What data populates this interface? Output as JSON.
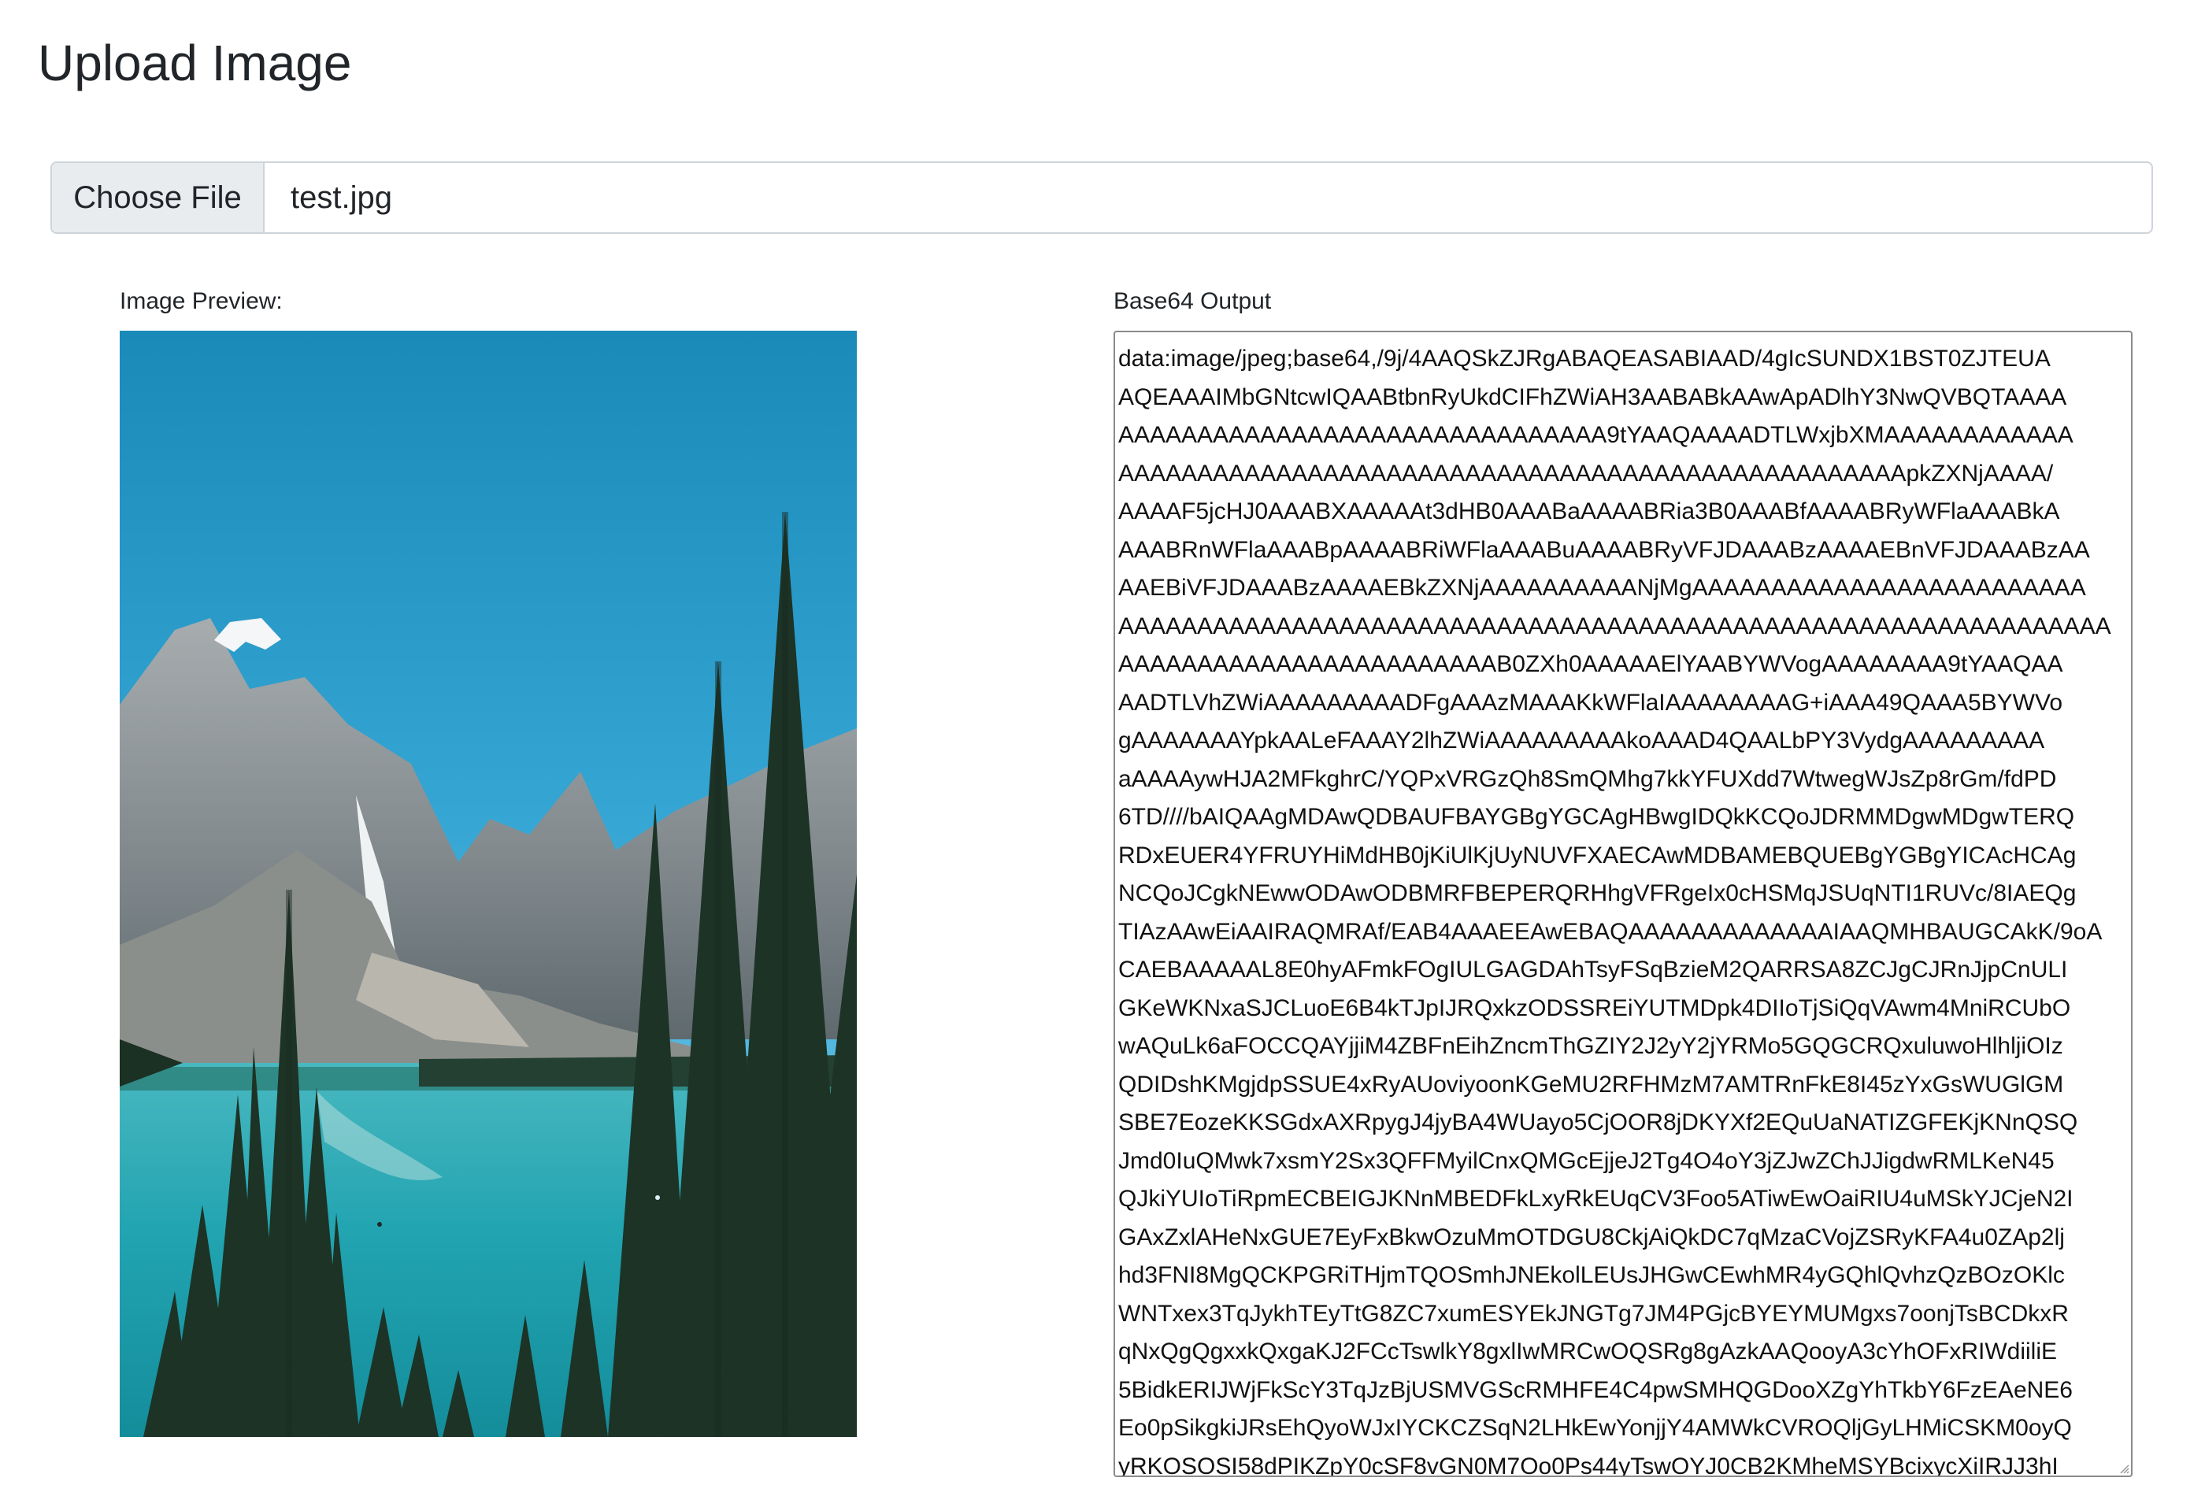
{
  "page": {
    "title": "Upload Image"
  },
  "file_input": {
    "button_label": "Choose File",
    "file_name": "test.jpg"
  },
  "preview": {
    "label": "Image Preview:"
  },
  "output": {
    "label": "Base64 Output",
    "value": "data:image/jpeg;base64,/9j/4AAQSkZJRgABAQEASABIAAD/4gIcSUNDX1BST0ZJTEUA\nAQEAAAIMbGNtcwIQAABtbnRyUkdCIFhZWiAH3AABABkAAwApADlhY3NwQVBQTAAAA\nAAAAAAAAAAAAAAAAAAAAAAAAAAAAAAA9tYAAQAAAADTLWxjbXMAAAAAAAAAAAA\nAAAAAAAAAAAAAAAAAAAAAAAAAAAAAAAAAAAAAAAAAAAAAAAAAApkZXNjAAAA/\nAAAAF5jcHJ0AAABXAAAAAt3dHB0AAABaAAAABRia3B0AAABfAAAABRyWFlaAAABkA\nAAABRnWFlaAAABpAAAABRiWFlaAAABuAAAABRyVFJDAAABzAAAAEBnVFJDAAABzAA\nAAEBiVFJDAAABzAAAAEBkZXNjAAAAAAAAAANjMgAAAAAAAAAAAAAAAAAAAAAAAAA\nAAAAAAAAAAAAAAAAAAAAAAAAAAAAAAAAAAAAAAAAAAAAAAAAAAAAAAAAAAAAAAA\nAAAAAAAAAAAAAAAAAAAAAAAAB0ZXh0AAAAAElYAABYWVogAAAAAAAA9tYAAQAA\nAADTLVhZWiAAAAAAAAADFgAAAzMAAAKkWFlaIAAAAAAAAG+iAAA49QAAA5BYWVo\ngAAAAAAAYpkAALeFAAAY2lhZWiAAAAAAAAAkoAAAD4QAALbPY3VydgAAAAAAAAA\naAAAAywHJA2MFkghrC/YQPxVRGzQh8SmQMhg7kkYFUXdd7WtwegWJsZp8rGm/fdPD\n6TD////bAIQAAgMDAwQDBAUFBAYGBgYGCAgHBwgIDQkKCQoJDRMMDgwMDgwTERQ\nRDxEUER4YFRUYHiMdHB0jKiUlKjUyNUVFXAECAwMDBAMEBQUEBgYGBgYICAcHCAg\nNCQoJCgkNEwwODAwODBMRFBEPERQRHhgVFRgeIx0cHSMqJSUqNTI1RUVc/8IAEQg\nTIAzAAwEiAAIRAQMRAf/EAB4AAAEEAwEBAQAAAAAAAAAAAAAIAAQMHBAUGCAkK/9oA\nCAEBAAAAAL8E0hyAFmkFOgIULGAGDAhTsyFSqBzieM2QARRSA8ZCJgCJRnJjpCnULI\nGKeWKNxaSJCLuoE6B4kTJpIJRQxkzODSSREiYUTMDpk4DIIoTjSiQqVAwm4MniRCUbO\nwAQuLk6aFOCCQAYjjiM4ZBFnEihZncmThGZIY2J2yY2jYRMo5GQGCRQxuluwoHlhljiOIz\nQDIDshKMgjdpSSUE4xRyAUoviyoonKGeMU2RFHMzM7AMTRnFkE8I45zYxGsWUGlGM\nSBE7EozeKKSGdxAXRpygJ4jyBA4WUayo5CjOOR8jDKYXf2EQuUaNATIZGFEKjKNnQSQ\nJmd0IuQMwk7xsmY2Sx3QFFMyilCnxQMGcEjjeJ2Tg4O4oY3jZJwZChJJigdwRMLKeN45\nQJkiYUIoTiRpmECBEIGJKNnMBEDFkLxyRkEUqCV3Foo5ATiwEwOaiRIU4uMSkYJCjeN2I\nGAxZxlAHeNxGUE7EyFxBkwOzuMmOTDGU8CkjAiQkDC7qMzaCVojZSRyKFA4u0ZAp2lj\nhd3FNI8MgQCKPGRiTHjmTQOSmhJNEkolLEUsJHGwCEwhMR4yGQhlQvhzQzBOzOKlc\nWNTxex3TqJykhTEyTtG8ZC7xumESYEkJNGTg7JM4PGjcBYEYMUMgxs7oonjTsBCDkxR\nqNxQgQgxxkQxgaKJ2FCcTswlkY8gxlIwMRCwOQSRg8gAzkAAQooyA3cYhOFxRIWdiiliE\n5BidkERIJWjFkScY3TqJzBjUSMVGScRMHFE4C4pwSMHQGDooXZgYhTkbY6FzEAeNE6\nEo0pSikgkiJRsEhQyoWJxIYCKCZSqN2LHkEwYonjjY4AMWkCVROQljGyLHMiCSKM0oyQ\nyRKOSOSI58dPIKZpY0cSF8vGN0M7Oo0Ps44yTswOYJ0CB2KMheMSYBcixycXiIRJJ3hI"
  },
  "colors": {
    "sky_top": "#1c8cbf",
    "sky_bottom": "#56bbe0",
    "lake": "#23a8b4",
    "tree": "#1d3326",
    "mountain": "#8f979b"
  },
  "icons": {
    "resize_grip": "resize-grip-icon"
  }
}
